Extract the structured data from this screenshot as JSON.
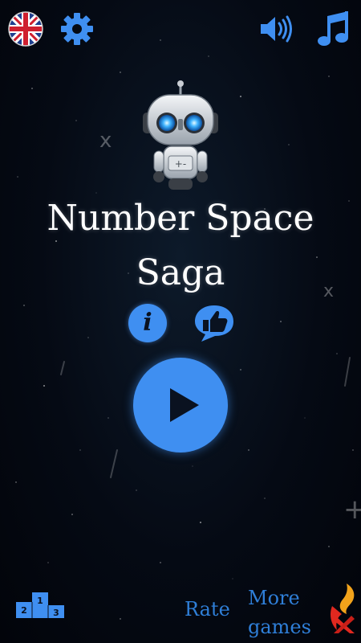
{
  "top_bar": {
    "language_icon": "uk-flag-icon",
    "settings_icon": "gear-icon",
    "sound_icon": "speaker-icon",
    "music_icon": "music-note-icon"
  },
  "title": {
    "line1": "Number Space",
    "line2": "Saga"
  },
  "buttons": {
    "info_symbol": "i",
    "like_icon": "thumbs-up-icon",
    "play_icon": "play-icon"
  },
  "bottom_bar": {
    "leaderboard_icon": "podium-icon",
    "podium_places": [
      "2",
      "1",
      "3"
    ],
    "rate_label": "Rate",
    "more_games_line1": "More",
    "more_games_line2": "games"
  },
  "background_symbols": [
    "x",
    "x",
    "+"
  ],
  "colors": {
    "accent": "#3f8ff1",
    "link": "#2f7fd8",
    "title": "#ffffff",
    "background": "#050a14"
  }
}
